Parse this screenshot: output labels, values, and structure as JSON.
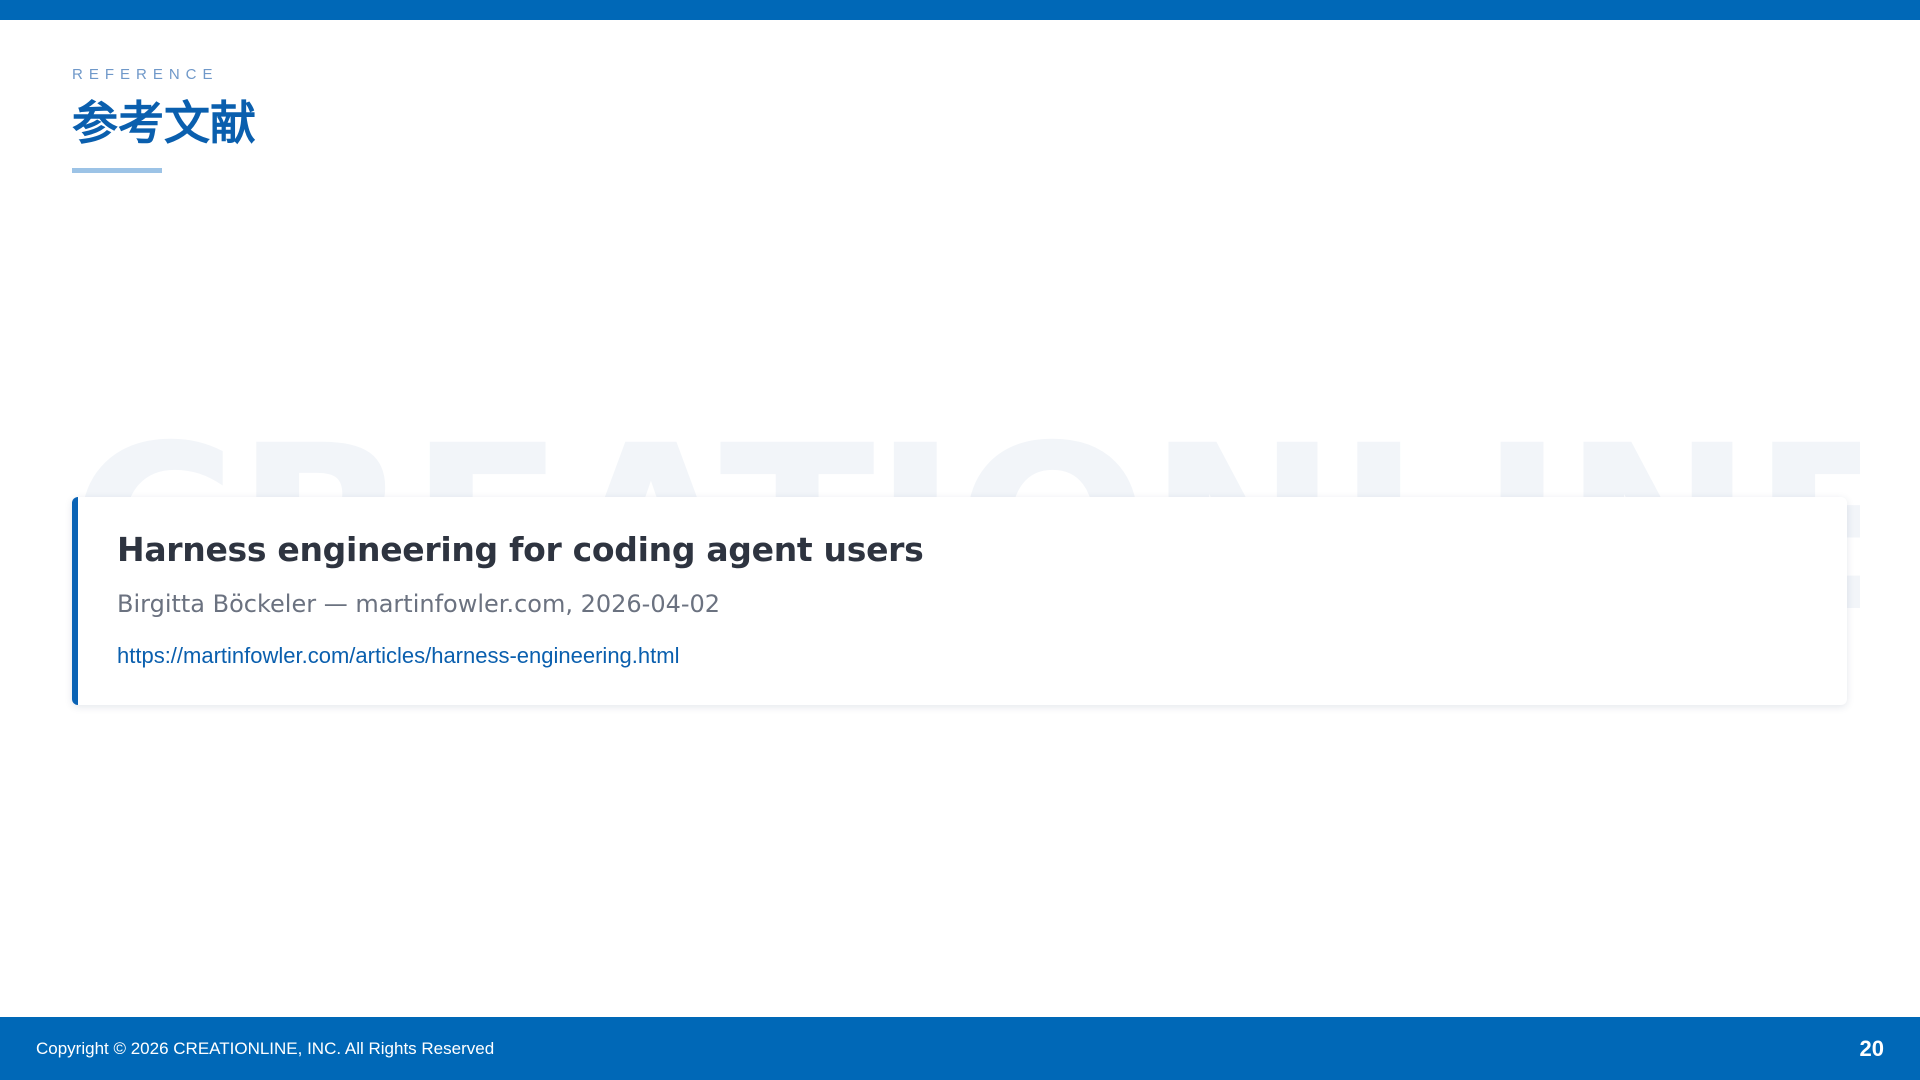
{
  "header": {
    "eyebrow": "REFERENCE",
    "title": "参考文献"
  },
  "watermark": {
    "text": "CREATIONLINE"
  },
  "reference": {
    "title": "Harness engineering for coding agent users",
    "meta": "Birgitta Böckeler — martinfowler.com, 2026-04-02",
    "url": "https://martinfowler.com/articles/harness-engineering.html"
  },
  "footer": {
    "copyright": "Copyright © 2026 CREATIONLINE, INC. All Rights Reserved",
    "page_number": "20"
  },
  "colors": {
    "brand_blue": "#0068b7",
    "title_blue": "#0a5fae",
    "accent_light": "#9cc3e6",
    "eyebrow": "#6f98c9",
    "watermark": "#f2f5f9"
  }
}
